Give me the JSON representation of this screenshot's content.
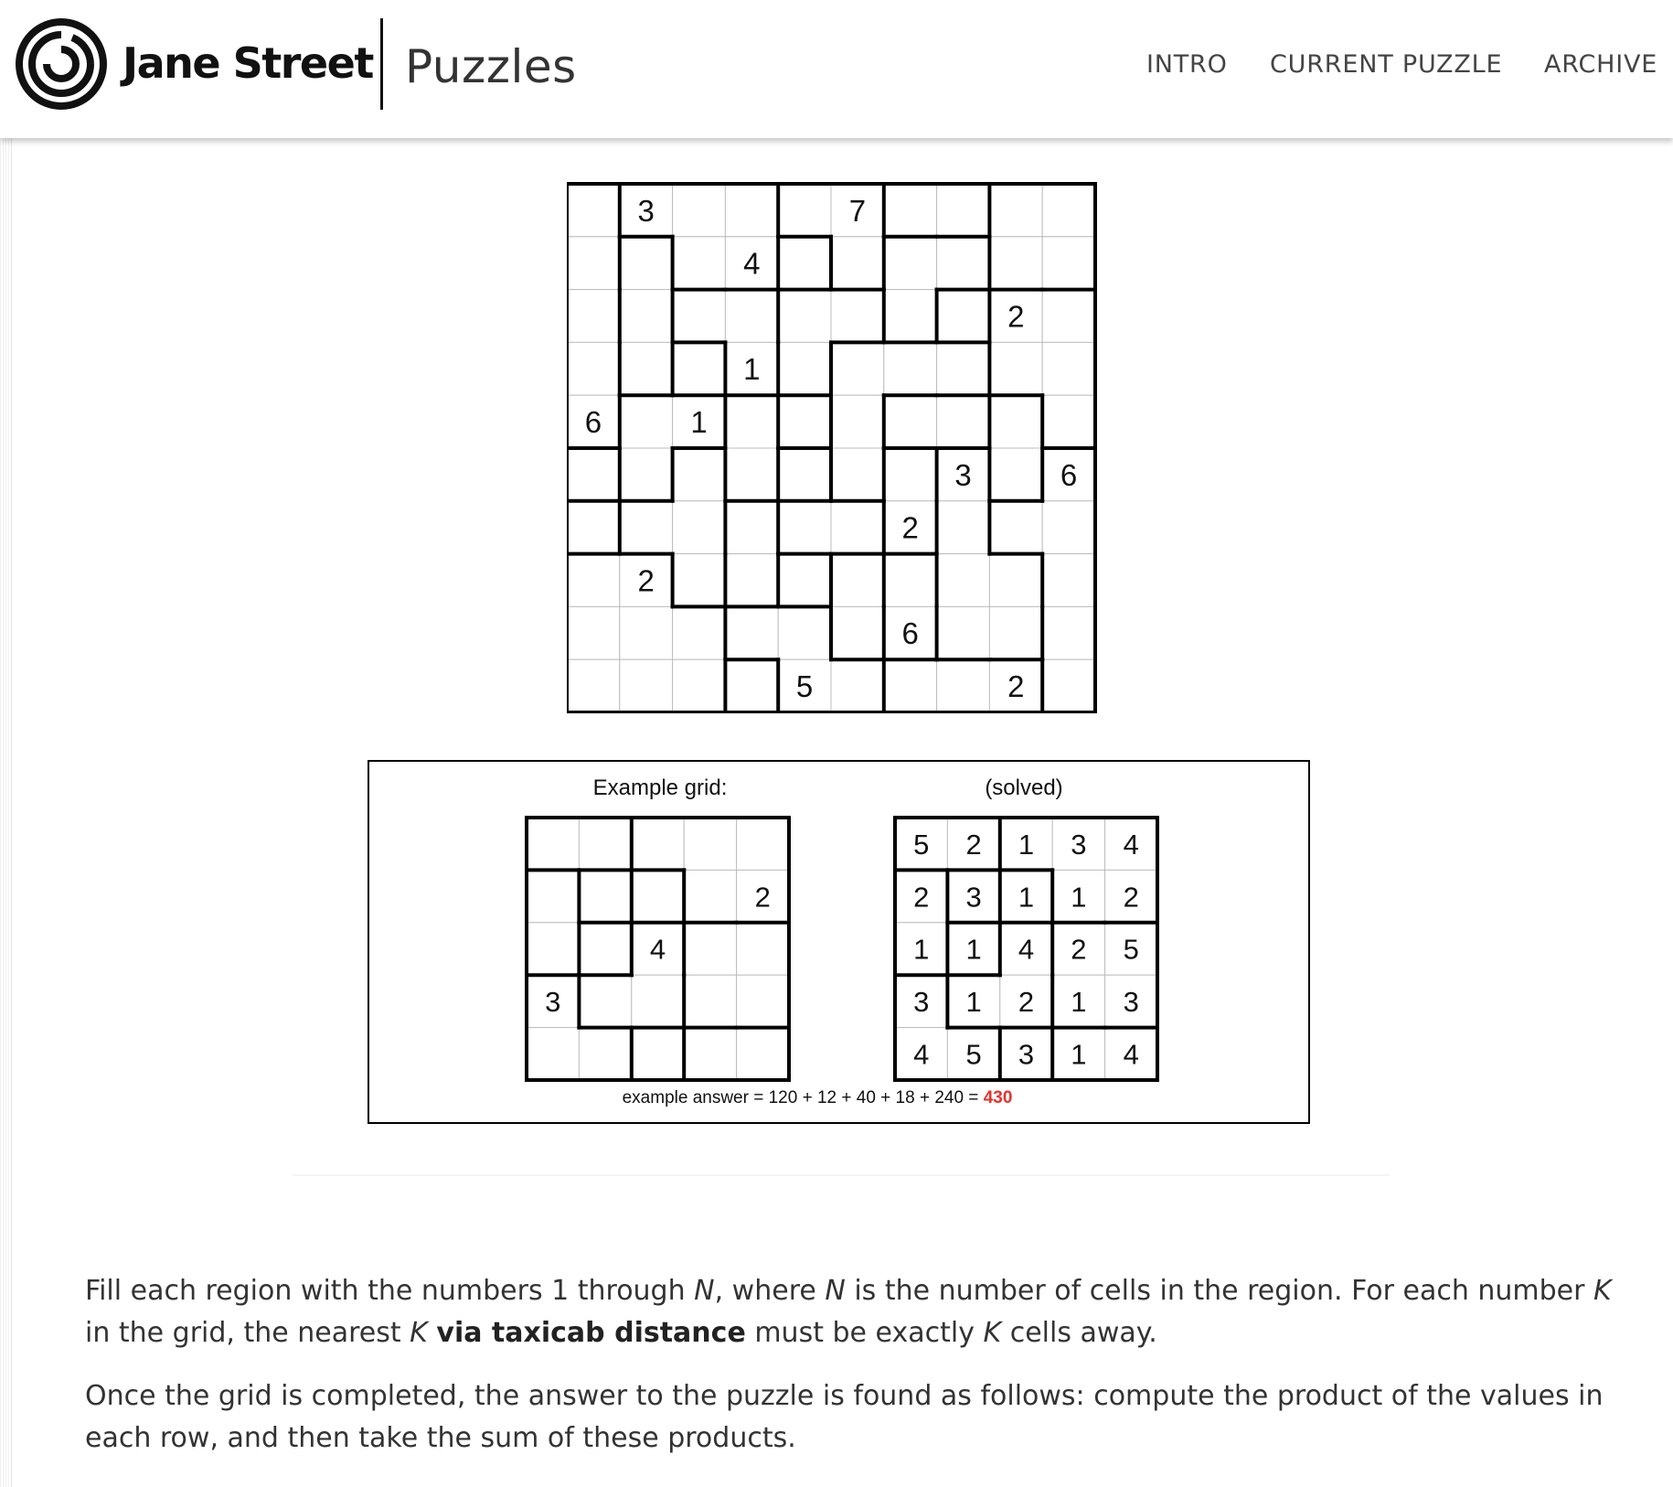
{
  "header": {
    "brand": "Jane Street",
    "section": "Puzzles",
    "nav": {
      "intro": "INTRO",
      "current": "CURRENT PUZZLE",
      "archive": "ARCHIVE"
    }
  },
  "puzzle": {
    "size": 10,
    "givens": [
      {
        "r": 0,
        "c": 1,
        "v": "3"
      },
      {
        "r": 0,
        "c": 5,
        "v": "7"
      },
      {
        "r": 1,
        "c": 3,
        "v": "4"
      },
      {
        "r": 2,
        "c": 8,
        "v": "2"
      },
      {
        "r": 3,
        "c": 3,
        "v": "1"
      },
      {
        "r": 4,
        "c": 0,
        "v": "6"
      },
      {
        "r": 4,
        "c": 2,
        "v": "1"
      },
      {
        "r": 5,
        "c": 7,
        "v": "3"
      },
      {
        "r": 5,
        "c": 9,
        "v": "6"
      },
      {
        "r": 6,
        "c": 6,
        "v": "2"
      },
      {
        "r": 7,
        "c": 1,
        "v": "2"
      },
      {
        "r": 8,
        "c": 6,
        "v": "6"
      },
      {
        "r": 9,
        "c": 4,
        "v": "5"
      },
      {
        "r": 9,
        "c": 8,
        "v": "2"
      }
    ]
  },
  "example": {
    "label": "Example grid:",
    "solved_label": "(solved)",
    "givens": [
      {
        "r": 1,
        "c": 4,
        "v": "2"
      },
      {
        "r": 2,
        "c": 2,
        "v": "4"
      },
      {
        "r": 3,
        "c": 0,
        "v": "3"
      }
    ],
    "solution": [
      [
        "5",
        "2",
        "1",
        "3",
        "4"
      ],
      [
        "2",
        "3",
        "1",
        "1",
        "2"
      ],
      [
        "1",
        "1",
        "4",
        "2",
        "5"
      ],
      [
        "3",
        "1",
        "2",
        "1",
        "3"
      ],
      [
        "4",
        "5",
        "3",
        "1",
        "4"
      ]
    ],
    "answer_prefix": "example answer = 120 + 12 + 40 + 18 + 240 = ",
    "answer_value": "430",
    "answer_color": "#e8312a"
  },
  "text": {
    "p1": {
      "a": "Fill each region with the numbers 1 through ",
      "n1": "N",
      "b": ", where ",
      "n2": "N",
      "c": " is the number of cells in the region. For each number ",
      "k1": "K",
      "d": " in the grid, the nearest ",
      "k2": "K",
      "e": " ",
      "bold": "via taxicab distance",
      "f": " must be exactly ",
      "k3": "K",
      "g": " cells away."
    },
    "p2": "Once the grid is completed, the answer to the puzzle is found as follows: compute the product of the values in each row, and then take the sum of these products."
  }
}
